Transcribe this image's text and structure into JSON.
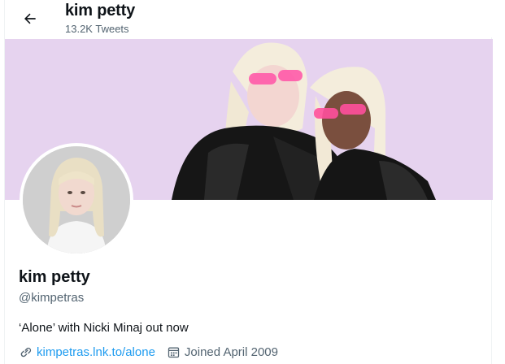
{
  "header": {
    "back_icon": "arrow-left-icon",
    "name": "kim petty",
    "tweet_count": "13.2K Tweets"
  },
  "profile": {
    "display_name": "kim petty",
    "handle": "@kimpetras",
    "bio": "‘Alone’ with Nicki Minaj out now",
    "link_text": "kimpetras.lnk.to/alone",
    "joined": "Joined April 2009"
  },
  "icons": {
    "link": "link-icon",
    "calendar": "calendar-icon"
  },
  "colors": {
    "accent": "#1d9bf0",
    "secondary_text": "#536471",
    "banner_bg": "#e8d6f0"
  }
}
